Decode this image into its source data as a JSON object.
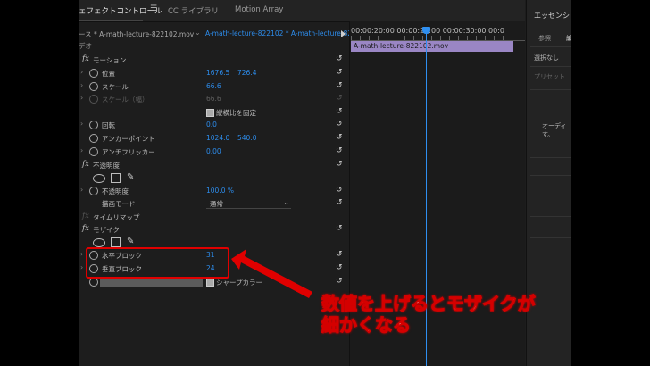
{
  "tabs": {
    "effect_controls": "ェフェクトコントロール",
    "menu": "☰",
    "cc_libraries": "CC ライブラリ",
    "motion_array": "Motion Array"
  },
  "source": {
    "master_clip": "ース * A-math-lecture-822102.mov",
    "active_clip": "A-math-lecture-822102 * A-math-lecture-8221"
  },
  "timeline": {
    "timecodes": "00:00:20:00  00:00:25:00  00:00:30:00  00:0",
    "clip_name": "A-math-lecture-822102.mov"
  },
  "video_header": "デオ",
  "motion": {
    "header": "モーション",
    "position_label": "位置",
    "position_x": "1676.5",
    "position_y": "726.4",
    "scale_label": "スケール",
    "scale_value": "66.6",
    "scale_w_label": "スケール（幅）",
    "scale_w_value": "66.6",
    "uniform_label": "縦横比を固定",
    "rotation_label": "回転",
    "rotation_value": "0.0",
    "anchor_label": "アンカーポイント",
    "anchor_x": "1024.0",
    "anchor_y": "540.0",
    "flicker_label": "アンチフリッカー",
    "flicker_value": "0.00"
  },
  "opacity": {
    "header": "不透明度",
    "opacity_label": "不透明度",
    "opacity_value": "100.0 %",
    "blend_label": "描画モード",
    "blend_value": "通常"
  },
  "time_remap": {
    "header": "タイムリマップ"
  },
  "mosaic": {
    "header": "モザイク",
    "horizontal_label": "水平ブロック",
    "horizontal_value": "31",
    "vertical_label": "垂直ブロック",
    "vertical_value": "24",
    "sharp_label": "シャープカラー"
  },
  "right_panel": {
    "title": "エッセンシャ",
    "tab_browse": "参照",
    "tab_edit": "編",
    "no_selection": "選択なし",
    "preset": "プリセット",
    "audio_line1": "オーディ",
    "audio_line2": "す。"
  },
  "annotation": {
    "line1": "数値を上げるとモザイクが",
    "line2": "細かくなる"
  },
  "colors": {
    "accent_blue": "#2d8ceb",
    "highlight_red": "#e00000",
    "clip_purple": "#9a86c4"
  }
}
